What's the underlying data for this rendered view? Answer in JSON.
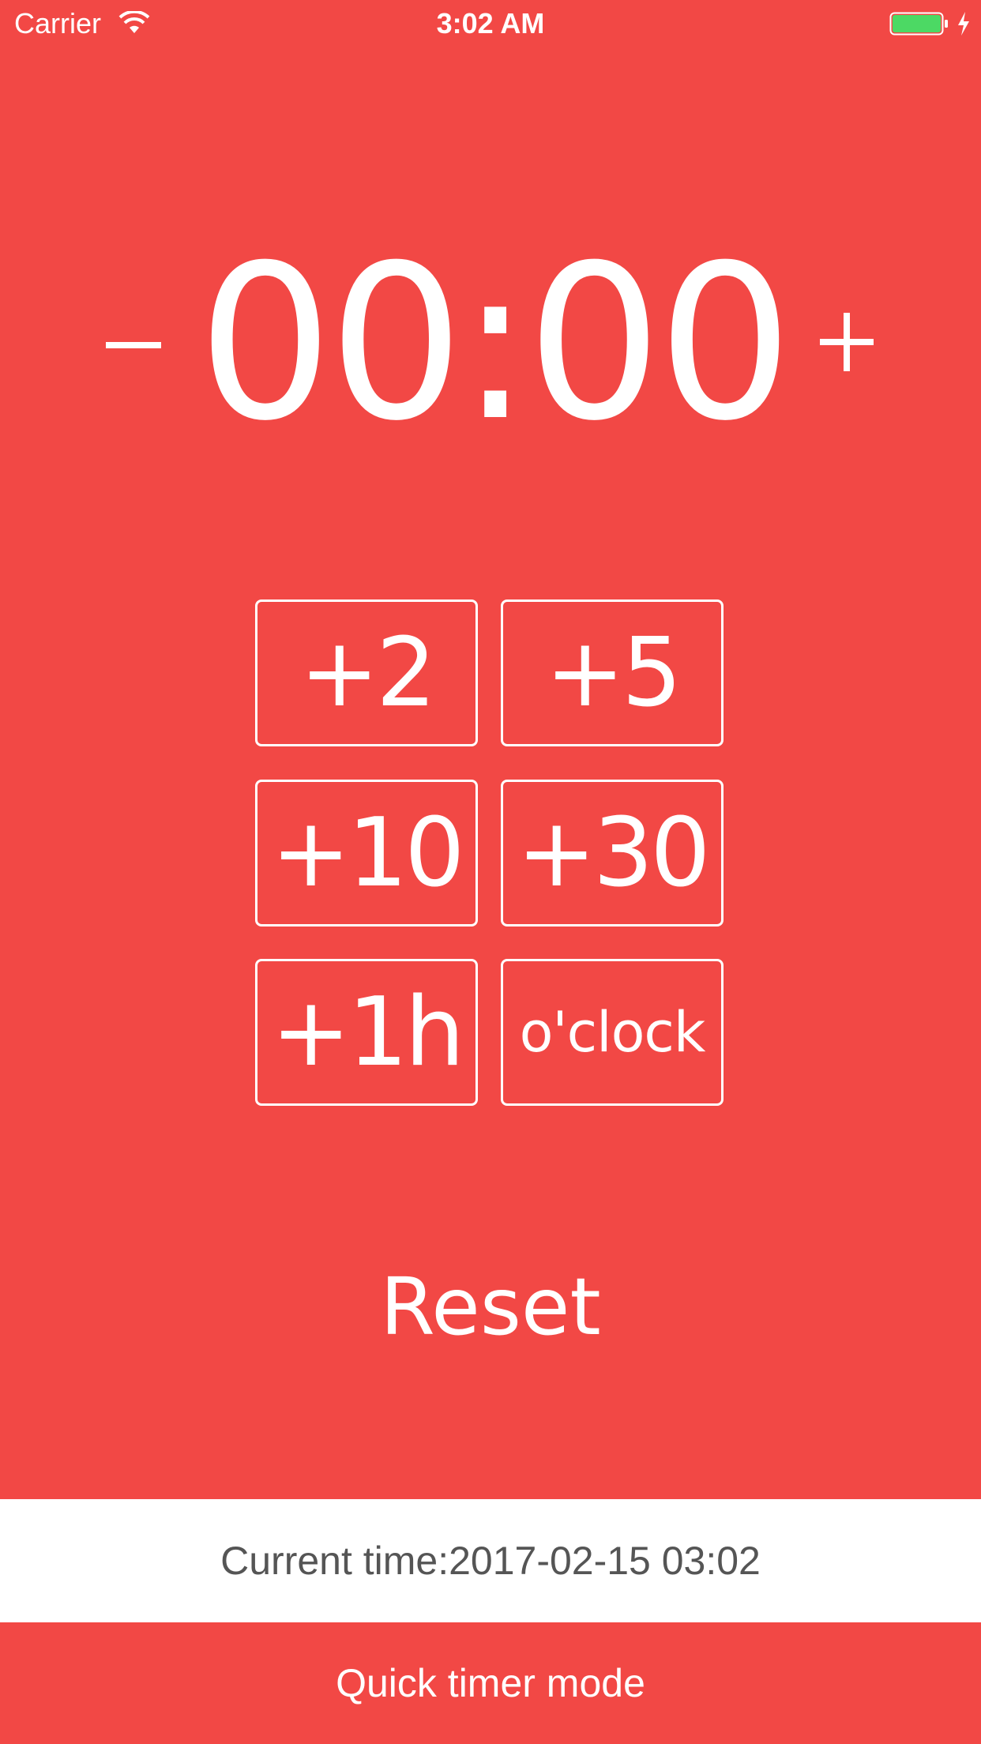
{
  "status_bar": {
    "carrier": "Carrier",
    "time": "3:02 AM",
    "wifi_icon": "wifi-icon",
    "battery_icon": "battery-icon",
    "battery_color": "#4CD964",
    "charging_icon": "charging-bolt-icon"
  },
  "timer": {
    "display": "00:00",
    "decrement_icon": "minus-icon",
    "increment_icon": "plus-icon"
  },
  "quick_add": {
    "buttons": [
      {
        "label": "+2"
      },
      {
        "label": "+5"
      },
      {
        "label": "+10"
      },
      {
        "label": "+30"
      },
      {
        "label": "+1h"
      },
      {
        "label": "o'clock"
      }
    ]
  },
  "reset_label": "Reset",
  "current_time": {
    "text": "Current time:2017-02-15 03:02"
  },
  "mode": {
    "label": "Quick timer mode"
  },
  "colors": {
    "background": "#F24845",
    "panel": "#FFFFFF",
    "panel_text": "#555555",
    "foreground": "#FFFFFF"
  }
}
